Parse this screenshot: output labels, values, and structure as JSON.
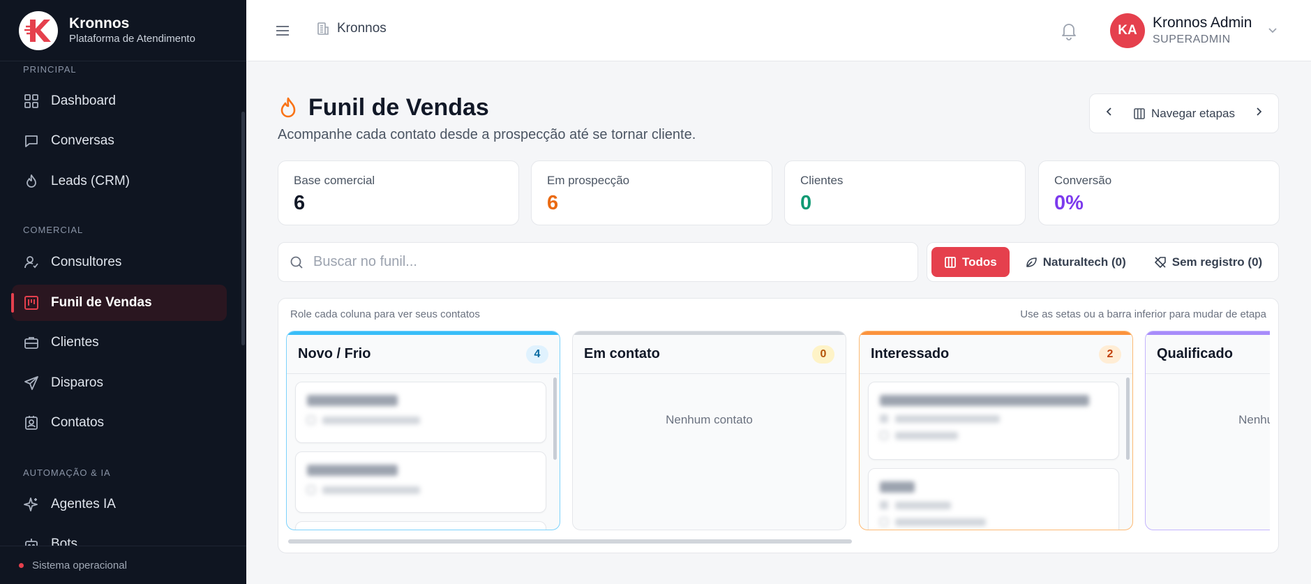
{
  "brand": {
    "name": "Kronnos",
    "subtitle": "Plataforma de Atendimento"
  },
  "sidebar": {
    "sections": [
      {
        "label": "PRINCIPAL"
      },
      {
        "label": "COMERCIAL"
      },
      {
        "label": "AUTOMAÇÃO & IA"
      }
    ],
    "items": [
      {
        "label": "Dashboard",
        "icon": "grid-icon"
      },
      {
        "label": "Conversas",
        "icon": "chat-icon"
      },
      {
        "label": "Leads (CRM)",
        "icon": "flame-icon"
      },
      {
        "label": "Consultores",
        "icon": "user-check-icon"
      },
      {
        "label": "Funil de Vendas",
        "icon": "kanban-icon",
        "active": true
      },
      {
        "label": "Clientes",
        "icon": "briefcase-icon"
      },
      {
        "label": "Disparos",
        "icon": "send-icon"
      },
      {
        "label": "Contatos",
        "icon": "contact-card-icon"
      },
      {
        "label": "Agentes IA",
        "icon": "sparkle-icon"
      },
      {
        "label": "Bots",
        "icon": "bot-icon"
      }
    ],
    "status": "Sistema operacional"
  },
  "header": {
    "breadcrumb": "Kronnos",
    "user": {
      "initials": "KA",
      "name": "Kronnos Admin",
      "role": "SUPERADMIN"
    }
  },
  "page": {
    "title": "Funil de Vendas",
    "subtitle": "Acompanhe cada contato desde a prospecção até se tornar cliente.",
    "stage_nav_label": "Navegar etapas"
  },
  "stats": [
    {
      "label": "Base comercial",
      "value": "6",
      "color": "#111827"
    },
    {
      "label": "Em prospecção",
      "value": "6",
      "color": "#ea6a12"
    },
    {
      "label": "Clientes",
      "value": "0",
      "color": "#0f9a73"
    },
    {
      "label": "Conversão",
      "value": "0%",
      "color": "#7c3aed"
    }
  ],
  "search": {
    "placeholder": "Buscar no funil..."
  },
  "filters": [
    {
      "label": "Todos",
      "active": true
    },
    {
      "label": "Naturaltech (0)",
      "active": false
    },
    {
      "label": "Sem registro (0)",
      "active": false
    }
  ],
  "board": {
    "hint_left": "Role cada coluna para ver seus contatos",
    "hint_right": "Use as setas ou a barra inferior para mudar de etapa",
    "empty_text": "Nenhum contato",
    "columns": [
      {
        "title": "Novo / Frio",
        "count": "4",
        "accent": "#38bdf8",
        "badge_bg": "#e0f2fe",
        "badge_fg": "#0369a1"
      },
      {
        "title": "Em contato",
        "count": "0",
        "accent": "#d1d5db",
        "badge_bg": "#fef3c7",
        "badge_fg": "#b45309"
      },
      {
        "title": "Interessado",
        "count": "2",
        "accent": "#fb923c",
        "badge_bg": "#ffedd5",
        "badge_fg": "#c2410c"
      },
      {
        "title": "Qualificado",
        "count": "",
        "accent": "#a78bfa",
        "badge_bg": "#ede9fe",
        "badge_fg": "#6d28d9"
      }
    ]
  }
}
